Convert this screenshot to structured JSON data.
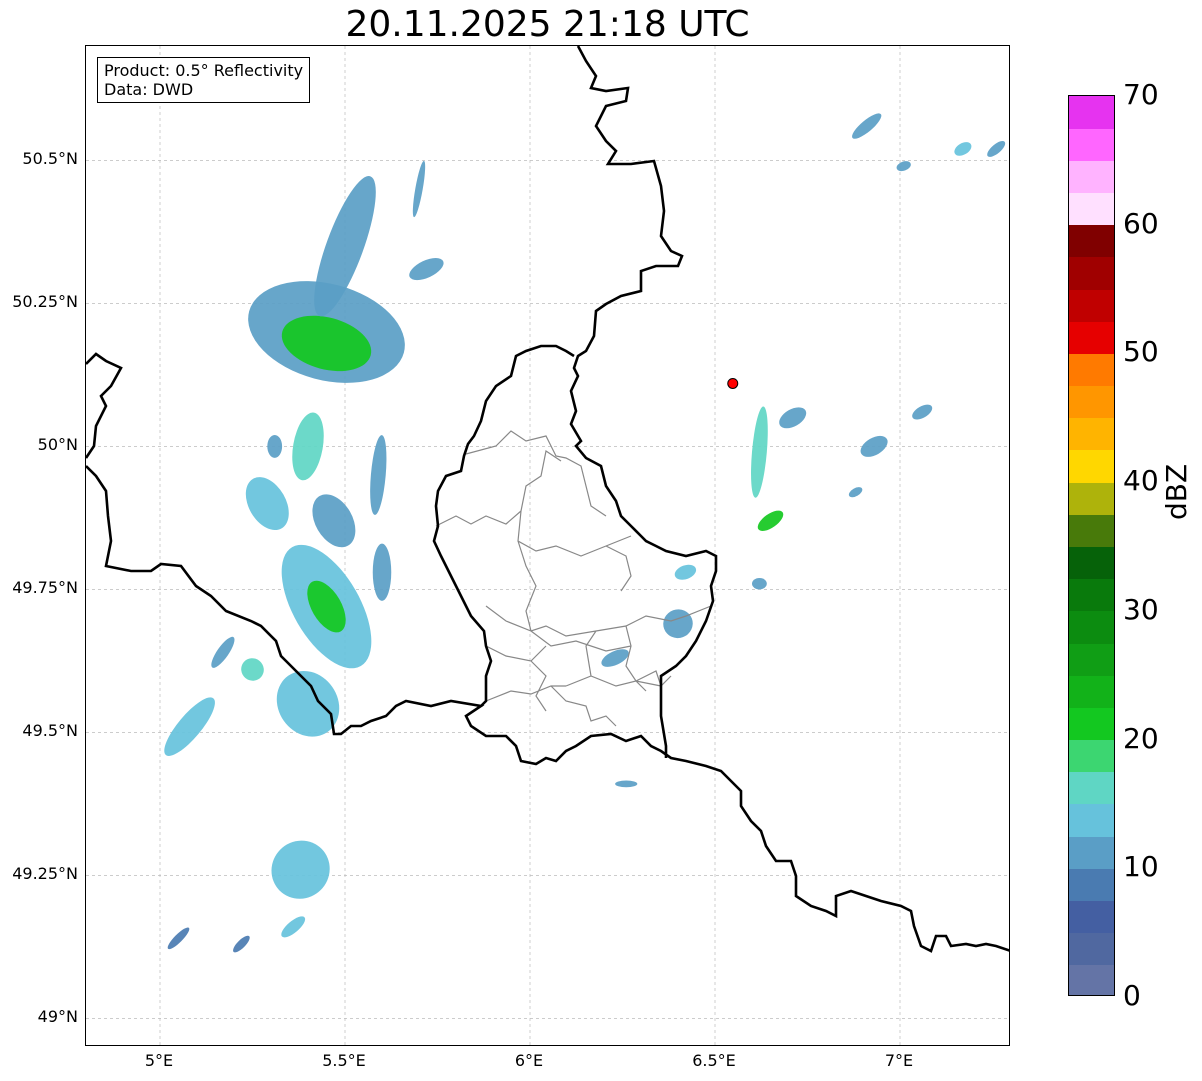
{
  "title": "20.11.2025 21:18 UTC",
  "info": {
    "product": "Product: 0.5° Reflectivity",
    "data": "Data: DWD"
  },
  "y_ticks": [
    {
      "label": "50.5°N",
      "value": 50.5
    },
    {
      "label": "50.25°N",
      "value": 50.25
    },
    {
      "label": "50°N",
      "value": 50.0
    },
    {
      "label": "49.75°N",
      "value": 49.75
    },
    {
      "label": "49.5°N",
      "value": 49.5
    },
    {
      "label": "49.25°N",
      "value": 49.25
    },
    {
      "label": "49°N",
      "value": 49.0
    }
  ],
  "x_ticks": [
    {
      "label": "5°E",
      "value": 5.0
    },
    {
      "label": "5.5°E",
      "value": 5.5
    },
    {
      "label": "6°E",
      "value": 6.0
    },
    {
      "label": "6.5°E",
      "value": 6.5
    },
    {
      "label": "7°E",
      "value": 7.0
    }
  ],
  "extent": {
    "lon": [
      4.8,
      7.3
    ],
    "lat": [
      48.95,
      50.7
    ]
  },
  "radar_site": {
    "lon": 6.548,
    "lat": 50.11,
    "color": "#ff0000"
  },
  "colorbar": {
    "unit": "dBZ",
    "range": [
      0,
      70
    ],
    "tick_labels": [
      "0",
      "10",
      "20",
      "30",
      "40",
      "50",
      "60",
      "70"
    ],
    "colors": [
      "#6474a6",
      "#5068a0",
      "#445fa2",
      "#4a7bb1",
      "#5a9ec6",
      "#66c2dc",
      "#5fd6c4",
      "#3cd671",
      "#13c820",
      "#12b219",
      "#109e15",
      "#0c8c10",
      "#097a0c",
      "#066209",
      "#487a0a",
      "#aeb30b",
      "#ffd700",
      "#ffb400",
      "#ff9600",
      "#ff7a00",
      "#e60000",
      "#c00000",
      "#a00000",
      "#800000",
      "#ffe0ff",
      "#ffb3ff",
      "#ff66ff",
      "#e633f0"
    ]
  },
  "echo_cells": [
    {
      "lon": 5.45,
      "lat": 50.2,
      "rx": 0.13,
      "ry": 0.14,
      "rot": -75,
      "dbz": 12
    },
    {
      "lon": 5.45,
      "lat": 50.18,
      "rx": 0.07,
      "ry": 0.08,
      "rot": -75,
      "dbz": 22
    },
    {
      "lon": 5.5,
      "lat": 50.35,
      "rx": 0.05,
      "ry": 0.13,
      "rot": 20,
      "dbz": 12
    },
    {
      "lon": 5.4,
      "lat": 50.0,
      "rx": 0.04,
      "ry": 0.06,
      "rot": 10,
      "dbz": 16
    },
    {
      "lon": 5.59,
      "lat": 49.95,
      "rx": 0.02,
      "ry": 0.07,
      "rot": 5,
      "dbz": 10
    },
    {
      "lon": 5.29,
      "lat": 49.9,
      "rx": 0.05,
      "ry": 0.05,
      "rot": -30,
      "dbz": 14
    },
    {
      "lon": 5.45,
      "lat": 49.72,
      "rx": 0.09,
      "ry": 0.12,
      "rot": -30,
      "dbz": 13
    },
    {
      "lon": 5.45,
      "lat": 49.72,
      "rx": 0.04,
      "ry": 0.05,
      "rot": -30,
      "dbz": 22
    },
    {
      "lon": 5.47,
      "lat": 49.87,
      "rx": 0.05,
      "ry": 0.05,
      "rot": -30,
      "dbz": 12
    },
    {
      "lon": 5.4,
      "lat": 49.55,
      "rx": 0.08,
      "ry": 0.06,
      "rot": -35,
      "dbz": 13
    },
    {
      "lon": 5.6,
      "lat": 49.78,
      "rx": 0.025,
      "ry": 0.05,
      "rot": 0,
      "dbz": 11
    },
    {
      "lon": 5.25,
      "lat": 49.61,
      "rx": 0.03,
      "ry": 0.02,
      "rot": -50,
      "dbz": 15
    },
    {
      "lon": 5.08,
      "lat": 49.51,
      "rx": 0.1,
      "ry": 0.02,
      "rot": -50,
      "dbz": 13
    },
    {
      "lon": 5.17,
      "lat": 49.64,
      "rx": 0.05,
      "ry": 0.01,
      "rot": -55,
      "dbz": 10
    },
    {
      "lon": 5.38,
      "lat": 49.26,
      "rx": 0.08,
      "ry": 0.05,
      "rot": -45,
      "dbz": 13
    },
    {
      "lon": 5.05,
      "lat": 49.14,
      "rx": 0.04,
      "ry": 0.007,
      "rot": -45,
      "dbz": 9
    },
    {
      "lon": 5.22,
      "lat": 49.13,
      "rx": 0.03,
      "ry": 0.007,
      "rot": -45,
      "dbz": 9
    },
    {
      "lon": 5.36,
      "lat": 49.16,
      "rx": 0.04,
      "ry": 0.01,
      "rot": -40,
      "dbz": 14
    },
    {
      "lon": 5.72,
      "lat": 50.31,
      "rx": 0.05,
      "ry": 0.015,
      "rot": -25,
      "dbz": 10
    },
    {
      "lon": 5.7,
      "lat": 50.45,
      "rx": 0.01,
      "ry": 0.05,
      "rot": 10,
      "dbz": 10
    },
    {
      "lon": 5.31,
      "lat": 50.0,
      "rx": 0.02,
      "ry": 0.02,
      "rot": 0,
      "dbz": 10
    },
    {
      "lon": 6.62,
      "lat": 49.99,
      "rx": 0.02,
      "ry": 0.08,
      "rot": 5,
      "dbz": 16
    },
    {
      "lon": 6.65,
      "lat": 49.87,
      "rx": 0.04,
      "ry": 0.012,
      "rot": -35,
      "dbz": 20
    },
    {
      "lon": 6.71,
      "lat": 50.05,
      "rx": 0.04,
      "ry": 0.015,
      "rot": -30,
      "dbz": 11
    },
    {
      "lon": 6.93,
      "lat": 50.0,
      "rx": 0.04,
      "ry": 0.015,
      "rot": -30,
      "dbz": 12
    },
    {
      "lon": 7.06,
      "lat": 50.06,
      "rx": 0.03,
      "ry": 0.01,
      "rot": -30,
      "dbz": 10
    },
    {
      "lon": 6.88,
      "lat": 49.92,
      "rx": 0.02,
      "ry": 0.007,
      "rot": -30,
      "dbz": 10
    },
    {
      "lon": 6.42,
      "lat": 49.78,
      "rx": 0.03,
      "ry": 0.012,
      "rot": -20,
      "dbz": 14
    },
    {
      "lon": 6.4,
      "lat": 49.69,
      "rx": 0.04,
      "ry": 0.025,
      "rot": -20,
      "dbz": 12
    },
    {
      "lon": 6.23,
      "lat": 49.63,
      "rx": 0.04,
      "ry": 0.012,
      "rot": -25,
      "dbz": 12
    },
    {
      "lon": 6.26,
      "lat": 49.41,
      "rx": 0.03,
      "ry": 0.006,
      "rot": 0,
      "dbz": 10
    },
    {
      "lon": 6.62,
      "lat": 49.76,
      "rx": 0.02,
      "ry": 0.01,
      "rot": 0,
      "dbz": 12
    },
    {
      "lon": 6.91,
      "lat": 50.56,
      "rx": 0.05,
      "ry": 0.01,
      "rot": -40,
      "dbz": 10
    },
    {
      "lon": 7.01,
      "lat": 50.49,
      "rx": 0.02,
      "ry": 0.008,
      "rot": -20,
      "dbz": 11
    },
    {
      "lon": 7.17,
      "lat": 50.52,
      "rx": 0.025,
      "ry": 0.01,
      "rot": -30,
      "dbz": 14
    },
    {
      "lon": 7.26,
      "lat": 50.52,
      "rx": 0.03,
      "ry": 0.008,
      "rot": -40,
      "dbz": 11
    }
  ]
}
